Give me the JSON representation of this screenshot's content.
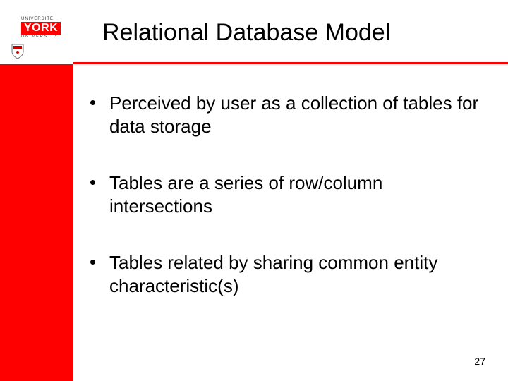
{
  "logo": {
    "top_text": "UNIVERSITÉ",
    "name": "YORK",
    "bottom_text": "UNIVERSITY"
  },
  "title": "Relational Database Model",
  "bullets": [
    "Perceived by user as a collection of tables for data storage",
    "Tables are a series of row/column intersections",
    "Tables related by sharing common entity characteristic(s)"
  ],
  "page_number": "27"
}
